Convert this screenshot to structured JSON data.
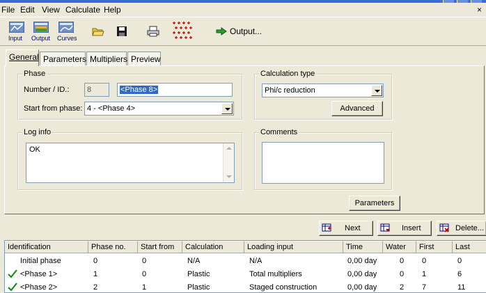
{
  "menu": {
    "items": [
      "File",
      "Edit",
      "View",
      "Calculate",
      "Help"
    ],
    "close_glyph": "×"
  },
  "toolbar": {
    "input_label": "Input",
    "output_label": "Output",
    "curves_label": "Curves",
    "output_button_label": "Output..."
  },
  "tabs": {
    "general": "General",
    "parameters": "Parameters",
    "multipliers": "Multipliers",
    "preview": "Preview"
  },
  "phase": {
    "title": "Phase",
    "number_label": "Number / ID.:",
    "number_value": "8",
    "id_value": "<Phase 8>",
    "start_label": "Start from phase:",
    "start_value": "4 - <Phase 4>"
  },
  "calc_type": {
    "title": "Calculation type",
    "value": "Phi/c reduction",
    "advanced_button": "Advanced"
  },
  "log": {
    "title": "Log info",
    "text": "OK"
  },
  "comments": {
    "title": "Comments",
    "text": ""
  },
  "parameters_button": "Parameters",
  "actions": {
    "next": "Next",
    "insert": "Insert",
    "delete": "Delete..."
  },
  "table": {
    "headers": [
      "Identification",
      "Phase no.",
      "Start from",
      "Calculation",
      "Loading input",
      "Time",
      "Water",
      "First",
      "Last"
    ],
    "rows": [
      {
        "id": "Initial phase",
        "checked": false,
        "phase_no": "0",
        "start": "0",
        "calc": "N/A",
        "loading": "N/A",
        "time": "0,00 day",
        "water": "0",
        "first": "0",
        "last": "0"
      },
      {
        "id": "<Phase 1>",
        "checked": true,
        "phase_no": "1",
        "start": "0",
        "calc": "Plastic",
        "loading": "Total multipliers",
        "time": "0,00 day",
        "water": "0",
        "first": "1",
        "last": "6"
      },
      {
        "id": "<Phase 2>",
        "checked": true,
        "phase_no": "2",
        "start": "1",
        "calc": "Plastic",
        "loading": "Staged construction",
        "time": "0,00 day",
        "water": "2",
        "first": "7",
        "last": "11"
      }
    ]
  },
  "colors": {
    "window": "#ece9d8",
    "selection": "#316ac5",
    "check": "#1a8c1a",
    "icon_blue": "#00007a"
  }
}
